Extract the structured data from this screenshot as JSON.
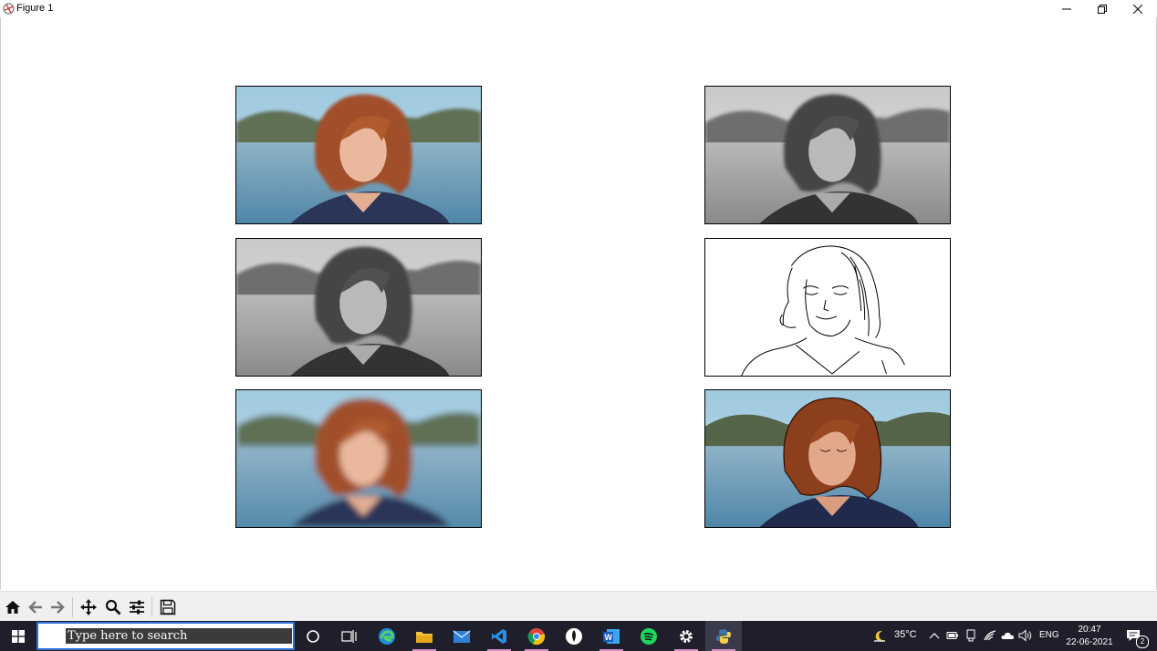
{
  "window": {
    "title": "Figure 1"
  },
  "figure": {
    "subplots": [
      {
        "position": "row-1-left",
        "content": "portrait photo, original color"
      },
      {
        "position": "row-1-right",
        "content": "portrait photo, grayscale"
      },
      {
        "position": "row-2-left",
        "content": "portrait photo, grayscale"
      },
      {
        "position": "row-2-right",
        "content": "edge-line sketch of portrait"
      },
      {
        "position": "row-3-left",
        "content": "portrait photo, smoothed color"
      },
      {
        "position": "row-3-right",
        "content": "portrait photo, sharpened color"
      }
    ]
  },
  "toolbar": {
    "buttons": [
      "home-icon",
      "back-arrow-icon",
      "forward-arrow-icon",
      "pan-icon",
      "zoom-icon",
      "configure-subplots-icon",
      "save-icon"
    ]
  },
  "taskbar": {
    "search_placeholder": "Type here to search",
    "weather": "35°C",
    "language": "ENG",
    "time": "20:47",
    "date": "22-06-2021",
    "notification_count": "2"
  }
}
